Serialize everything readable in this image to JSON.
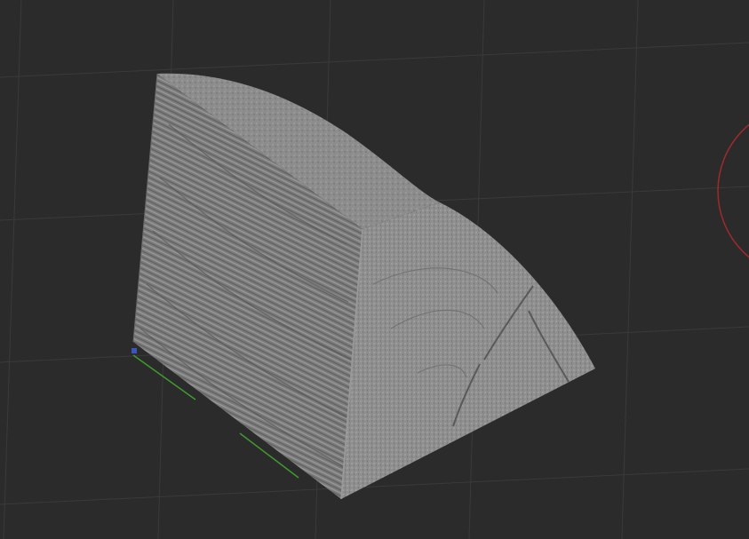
{
  "viewport": {
    "background_color": "#2b2b2b",
    "grid_color": "#3a3a3a",
    "axis_x_color": "#b23a3a",
    "axis_y_color": "#3f9a2e",
    "axis_z_color": "#3a55c0",
    "gizmo_ring_color": "#9e2b2b"
  },
  "model": {
    "name": "wood-log-quarter",
    "top_face_color": "#8c8c8c",
    "side_face_color": "#7a7a7a",
    "cross_section_color": "#8f8f8f",
    "crack_color": "#5a5a5a"
  }
}
